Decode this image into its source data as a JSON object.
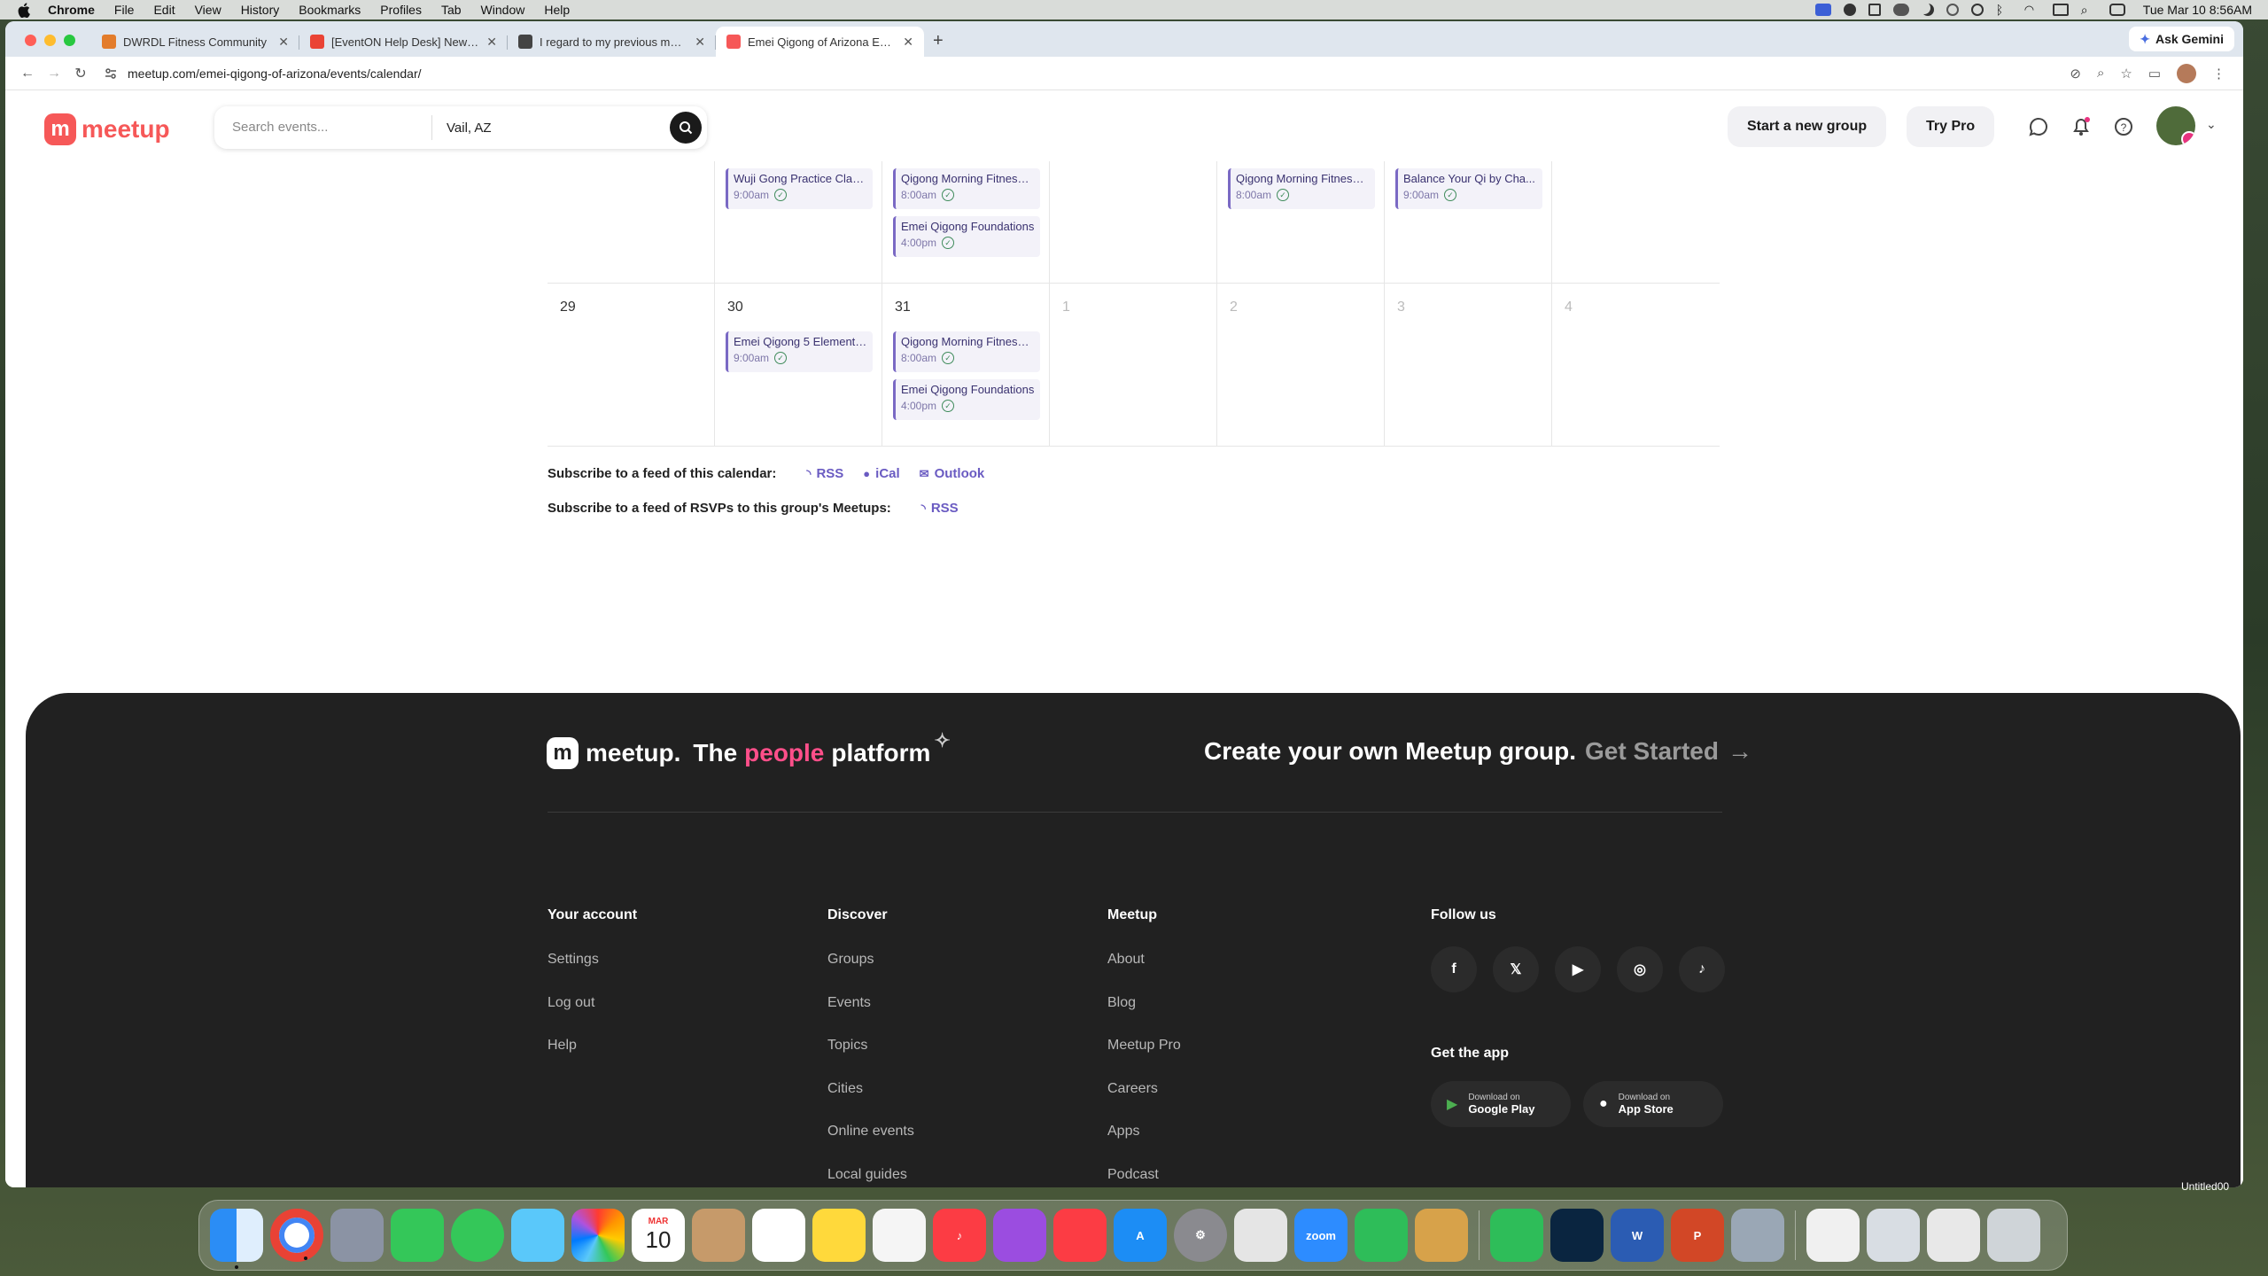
{
  "menubar": {
    "app": "Chrome",
    "items": [
      "File",
      "Edit",
      "View",
      "History",
      "Bookmarks",
      "Profiles",
      "Tab",
      "Window",
      "Help"
    ],
    "clock": "Tue Mar 10  8:56AM"
  },
  "browser": {
    "tabs": [
      {
        "label": "DWRDL Fitness Community",
        "color": "#e37c2b"
      },
      {
        "label": "[EventON Help Desk] New re",
        "color": "#ea4335"
      },
      {
        "label": "I regard to my previous mess",
        "color": "#444444"
      },
      {
        "label": "Emei Qigong of Arizona Event",
        "color": "#f65858"
      }
    ],
    "ask_gemini": "Ask Gemini",
    "url": "meetup.com/emei-qigong-of-arizona/events/calendar/"
  },
  "header": {
    "logo": "meetup",
    "search_placeholder": "Search events...",
    "location": "Vail, AZ",
    "start_group": "Start a new group",
    "try_pro": "Try Pro"
  },
  "calendar": {
    "week1": [
      {
        "day": "",
        "events": []
      },
      {
        "day": "",
        "events": [
          {
            "title": "Wuji Gong Practice Clas...",
            "time": "9:00am"
          }
        ]
      },
      {
        "day": "",
        "events": [
          {
            "title": "Qigong Morning Fitness ...",
            "time": "8:00am"
          },
          {
            "title": "Emei Qigong Foundations",
            "time": "4:00pm"
          }
        ]
      },
      {
        "day": "",
        "events": []
      },
      {
        "day": "",
        "events": [
          {
            "title": "Qigong Morning Fitness ...",
            "time": "8:00am"
          }
        ]
      },
      {
        "day": "",
        "events": [
          {
            "title": "Balance Your Qi by Cha...",
            "time": "9:00am"
          }
        ]
      },
      {
        "day": "",
        "events": []
      }
    ],
    "week2": [
      {
        "day": "29",
        "faded": false,
        "events": []
      },
      {
        "day": "30",
        "faded": false,
        "events": [
          {
            "title": "Emei Qigong 5 Elements...",
            "time": "9:00am"
          }
        ]
      },
      {
        "day": "31",
        "faded": false,
        "events": [
          {
            "title": "Qigong Morning Fitness ...",
            "time": "8:00am"
          },
          {
            "title": "Emei Qigong Foundations",
            "time": "4:00pm"
          }
        ]
      },
      {
        "day": "1",
        "faded": true,
        "events": []
      },
      {
        "day": "2",
        "faded": true,
        "events": []
      },
      {
        "day": "3",
        "faded": true,
        "events": []
      },
      {
        "day": "4",
        "faded": true,
        "events": []
      }
    ]
  },
  "subscribe": {
    "calendar_label": "Subscribe to a feed of this calendar:",
    "rss": "RSS",
    "ical": "iCal",
    "outlook": "Outlook",
    "rsvp_label": "Subscribe to a feed of RSVPs to this group's Meetups:",
    "rsvp_rss": "RSS"
  },
  "footer": {
    "brand": "meetup.",
    "tag_the": "The",
    "tag_people": "people",
    "tag_platform": "platform",
    "create": "Create your own Meetup group.",
    "get_started": "Get Started",
    "columns": [
      {
        "title": "Your account",
        "links": [
          "Settings",
          "Log out",
          "Help"
        ]
      },
      {
        "title": "Discover",
        "links": [
          "Groups",
          "Events",
          "Topics",
          "Cities",
          "Online events",
          "Local guides"
        ]
      },
      {
        "title": "Meetup",
        "links": [
          "About",
          "Blog",
          "Meetup Pro",
          "Careers",
          "Apps",
          "Podcast"
        ]
      }
    ],
    "follow_us": "Follow us",
    "get_the_app": "Get the app",
    "google_small": "Download on",
    "google_big": "Google Play",
    "apple_small": "Download on",
    "apple_big": "App Store"
  },
  "dock": {
    "calendar_month": "MAR",
    "calendar_day": "10",
    "zoom": "zoom",
    "untitled": "Untitled00"
  }
}
